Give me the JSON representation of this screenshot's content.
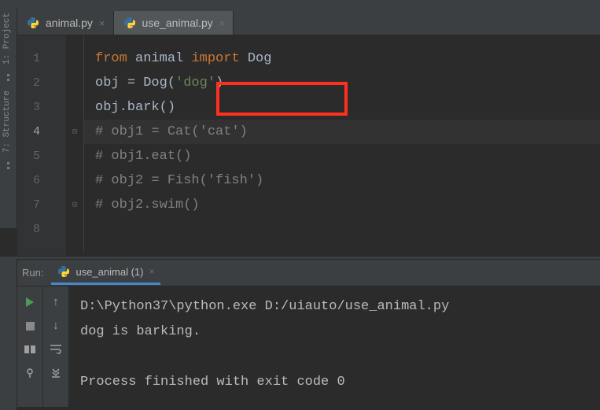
{
  "tabs": [
    {
      "name": "animal.py",
      "active": false
    },
    {
      "name": "use_animal.py",
      "active": true
    }
  ],
  "code": {
    "l1": {
      "kw1": "from",
      "mod": "animal",
      "kw2": "import",
      "cls": "Dog"
    },
    "l2": {
      "lhs": "obj",
      "op": "=",
      "call": "Dog(",
      "arg": "'dog'",
      "close": ")"
    },
    "l3": {
      "txt": "obj.bark()"
    },
    "l4": {
      "txt": "# obj1 = Cat('cat')"
    },
    "l5": {
      "txt": "# obj1.eat()"
    },
    "l6": {
      "txt": "# obj2 = Fish('fish')"
    },
    "l7": {
      "txt": "# obj2.swim()"
    },
    "l8": {
      "txt": ""
    }
  },
  "line_numbers": [
    "1",
    "2",
    "3",
    "4",
    "5",
    "6",
    "7",
    "8"
  ],
  "toolwin": {
    "project": "1: Project",
    "structure": "7: Structure"
  },
  "run": {
    "label": "Run:",
    "tab": "use_animal (1)",
    "out1": "D:\\Python37\\python.exe D:/uiauto/use_animal.py",
    "out2": "dog is barking.",
    "out3": "",
    "out4": "Process finished with exit code 0"
  }
}
